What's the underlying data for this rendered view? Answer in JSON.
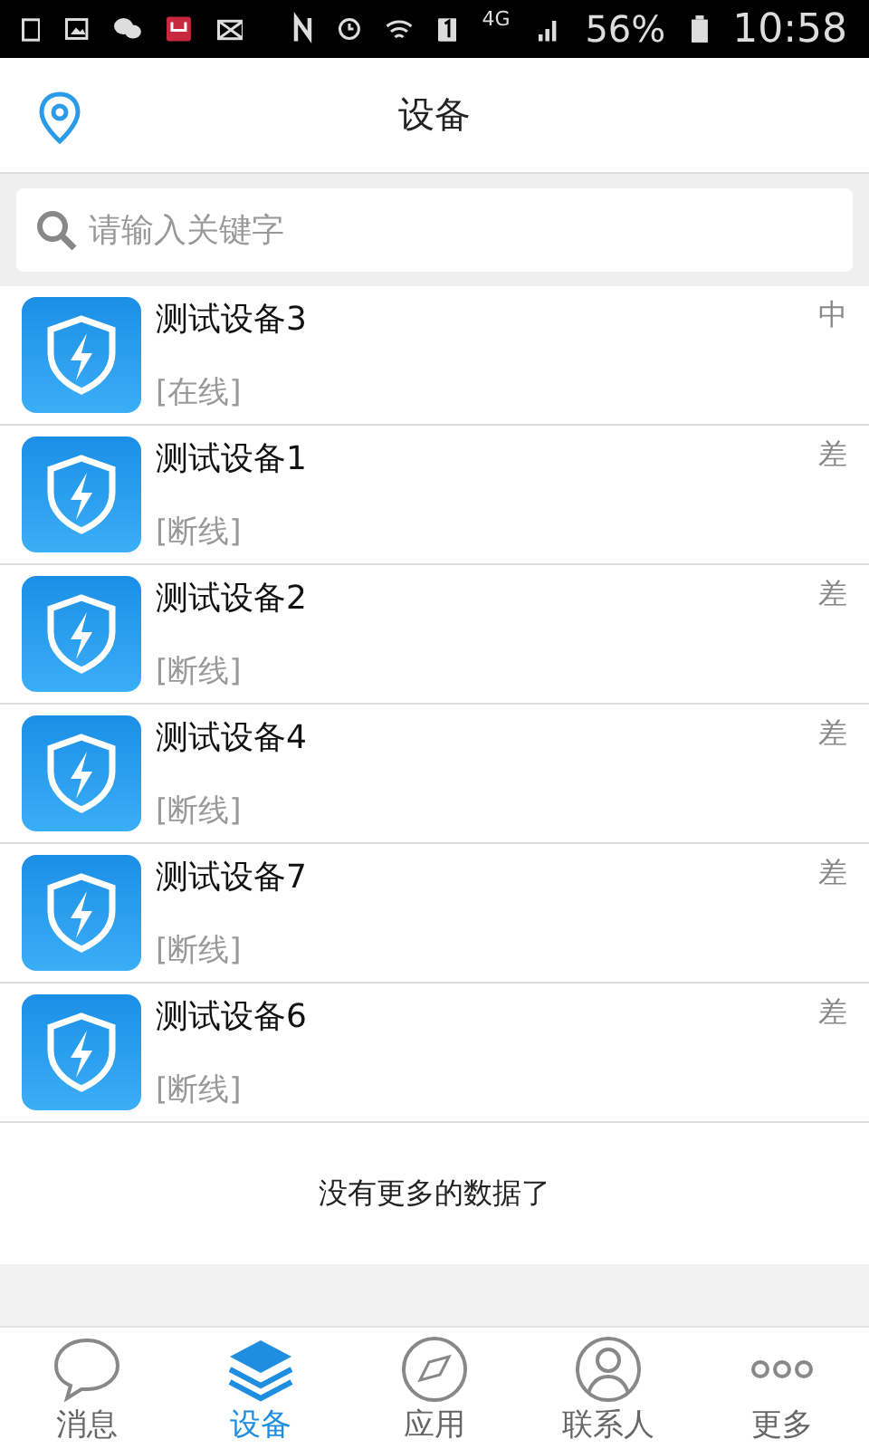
{
  "status_bar": {
    "network": "4G",
    "battery": "56%",
    "time": "10:58"
  },
  "header": {
    "title": "设备"
  },
  "search": {
    "placeholder": "请输入关键字"
  },
  "devices": [
    {
      "name": "测试设备3",
      "status": "[在线]",
      "signal": "中"
    },
    {
      "name": "测试设备1",
      "status": "[断线]",
      "signal": "差"
    },
    {
      "name": "测试设备2",
      "status": "[断线]",
      "signal": "差"
    },
    {
      "name": "测试设备4",
      "status": "[断线]",
      "signal": "差"
    },
    {
      "name": "测试设备7",
      "status": "[断线]",
      "signal": "差"
    },
    {
      "name": "测试设备6",
      "status": "[断线]",
      "signal": "差"
    }
  ],
  "footer_note": "没有更多的数据了",
  "bottom_nav": [
    {
      "label": "消息",
      "kind": "chat",
      "selected": false
    },
    {
      "label": "设备",
      "kind": "layers",
      "selected": true
    },
    {
      "label": "应用",
      "kind": "compass",
      "selected": false
    },
    {
      "label": "联系人",
      "kind": "person",
      "selected": false
    },
    {
      "label": "更多",
      "kind": "more",
      "selected": false
    }
  ]
}
